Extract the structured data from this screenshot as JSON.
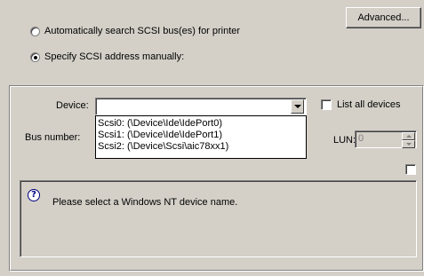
{
  "options": {
    "auto_search_label": "Automatically search SCSI bus(es) for printer",
    "specify_manual_label": "Specify SCSI address manually:",
    "selected": "specify_manual"
  },
  "advanced_button": "Advanced...",
  "form": {
    "device_label": "Device:",
    "device_value": "",
    "list_all_label": "List all devices",
    "bus_number_label": "Bus number:",
    "lun_label": "LUN:",
    "lun_value": "0"
  },
  "device_dropdown": {
    "items": [
      "Scsi0: (\\Device\\Ide\\IdePort0)",
      "Scsi1: (\\Device\\Ide\\IdePort1)",
      "Scsi2: (\\Device\\Scsi\\aic78xx1)"
    ]
  },
  "message": {
    "icon": "info-question-icon",
    "text": "Please select a Windows NT device name."
  }
}
